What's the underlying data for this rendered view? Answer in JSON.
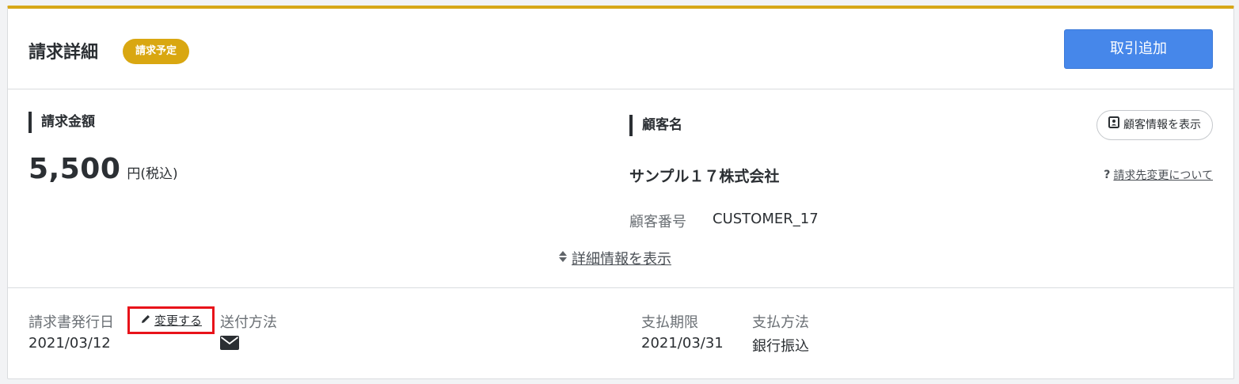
{
  "header": {
    "title": "請求詳細",
    "status_badge": "請求予定",
    "add_transaction_button": "取引追加"
  },
  "billing": {
    "label": "請求金額",
    "amount": "5,500",
    "unit": "円(税込)"
  },
  "customer": {
    "label": "顧客名",
    "show_info_button": "顧客情報を表示",
    "name": "サンプル１７株式会社",
    "help_link": "請求先変更について",
    "number_label": "顧客番号",
    "number": "CUSTOMER_17"
  },
  "detail_toggle": "詳細情報を表示",
  "footer": {
    "issue_date_label": "請求書発行日",
    "change_link": "変更する",
    "issue_date": "2021/03/12",
    "send_method_label": "送付方法",
    "payment_due_label": "支払期限",
    "payment_due": "2021/03/31",
    "payment_method_label": "支払方法",
    "payment_method": "銀行振込"
  },
  "colors": {
    "accent_top_border": "#d7a718",
    "badge": "#d9a711",
    "primary_button": "#4687ea",
    "highlight_box": "#e8131a"
  }
}
